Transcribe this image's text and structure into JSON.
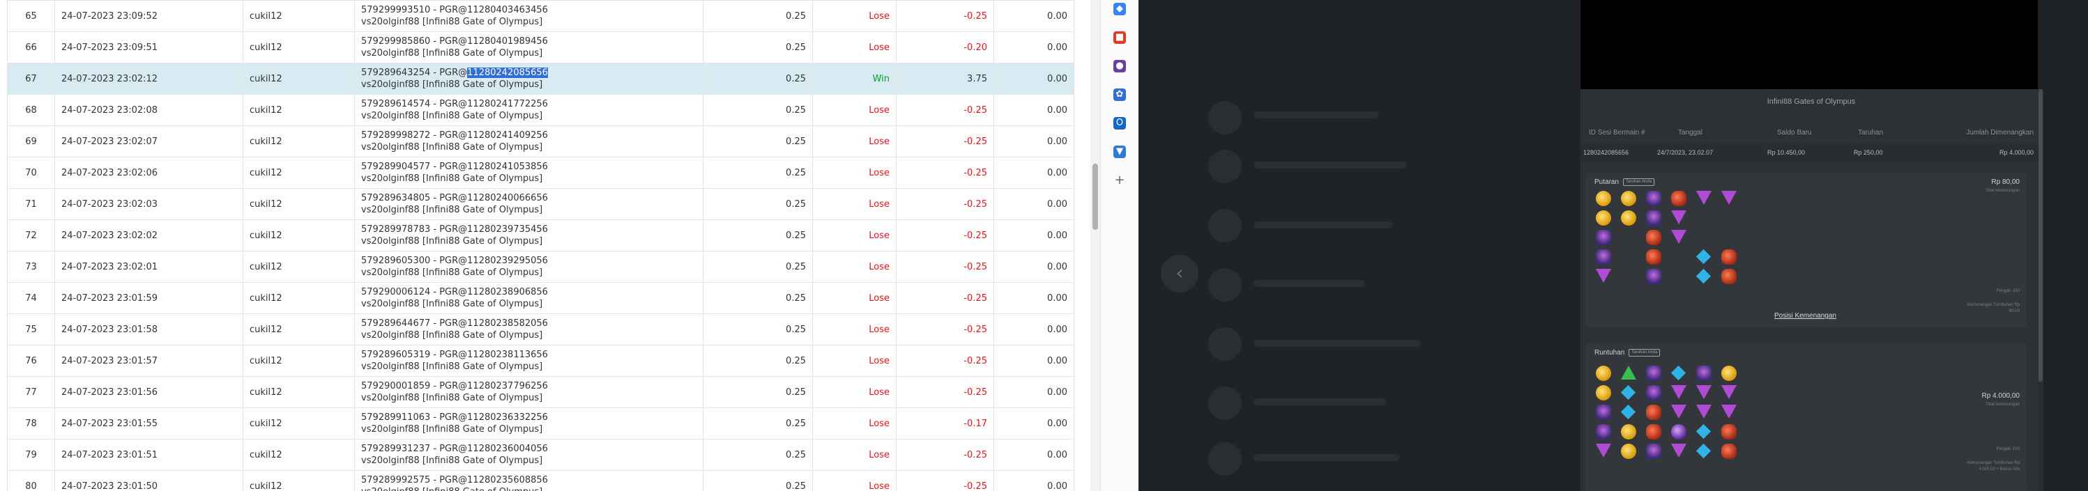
{
  "table": {
    "rows": [
      {
        "no": "65",
        "date": "24-07-2023 23:09:52",
        "user": "cukil12",
        "desc1": "579299993510 - PGR@11280403463456",
        "desc2": "vs20olginf88 [Infini88 Gate of Olympus]",
        "bet": "0.25",
        "result": "Lose",
        "amount": "-0.25",
        "balance": "0.00"
      },
      {
        "no": "66",
        "date": "24-07-2023 23:09:51",
        "user": "cukil12",
        "desc1": "579299985860 - PGR@11280401989456",
        "desc2": "vs20olginf88 [Infini88 Gate of Olympus]",
        "bet": "0.25",
        "result": "Lose",
        "amount": "-0.20",
        "balance": "0.00"
      },
      {
        "no": "67",
        "date": "24-07-2023 23:02:12",
        "user": "cukil12",
        "desc1": "579289643254 - PGR@",
        "desc1_hl": "11280242085656",
        "desc2": "vs20olginf88 [Infini88 Gate of Olympus]",
        "bet": "0.25",
        "result": "Win",
        "amount": "3.75",
        "balance": "0.00",
        "selected": true
      },
      {
        "no": "68",
        "date": "24-07-2023 23:02:08",
        "user": "cukil12",
        "desc1": "579289614574 - PGR@11280241772256",
        "desc2": "vs20olginf88 [Infini88 Gate of Olympus]",
        "bet": "0.25",
        "result": "Lose",
        "amount": "-0.25",
        "balance": "0.00"
      },
      {
        "no": "69",
        "date": "24-07-2023 23:02:07",
        "user": "cukil12",
        "desc1": "579289998272 - PGR@11280241409256",
        "desc2": "vs20olginf88 [Infini88 Gate of Olympus]",
        "bet": "0.25",
        "result": "Lose",
        "amount": "-0.25",
        "balance": "0.00"
      },
      {
        "no": "70",
        "date": "24-07-2023 23:02:06",
        "user": "cukil12",
        "desc1": "579289904577 - PGR@11280241053856",
        "desc2": "vs20olginf88 [Infini88 Gate of Olympus]",
        "bet": "0.25",
        "result": "Lose",
        "amount": "-0.25",
        "balance": "0.00"
      },
      {
        "no": "71",
        "date": "24-07-2023 23:02:03",
        "user": "cukil12",
        "desc1": "579289634805 - PGR@11280240066656",
        "desc2": "vs20olginf88 [Infini88 Gate of Olympus]",
        "bet": "0.25",
        "result": "Lose",
        "amount": "-0.25",
        "balance": "0.00"
      },
      {
        "no": "72",
        "date": "24-07-2023 23:02:02",
        "user": "cukil12",
        "desc1": "579289978783 - PGR@11280239735456",
        "desc2": "vs20olginf88 [Infini88 Gate of Olympus]",
        "bet": "0.25",
        "result": "Lose",
        "amount": "-0.25",
        "balance": "0.00"
      },
      {
        "no": "73",
        "date": "24-07-2023 23:02:01",
        "user": "cukil12",
        "desc1": "579289605300 - PGR@11280239295056",
        "desc2": "vs20olginf88 [Infini88 Gate of Olympus]",
        "bet": "0.25",
        "result": "Lose",
        "amount": "-0.25",
        "balance": "0.00"
      },
      {
        "no": "74",
        "date": "24-07-2023 23:01:59",
        "user": "cukil12",
        "desc1": "579290006124 - PGR@11280238906856",
        "desc2": "vs20olginf88 [Infini88 Gate of Olympus]",
        "bet": "0.25",
        "result": "Lose",
        "amount": "-0.25",
        "balance": "0.00"
      },
      {
        "no": "75",
        "date": "24-07-2023 23:01:58",
        "user": "cukil12",
        "desc1": "579289644677 - PGR@11280238582056",
        "desc2": "vs20olginf88 [Infini88 Gate of Olympus]",
        "bet": "0.25",
        "result": "Lose",
        "amount": "-0.25",
        "balance": "0.00"
      },
      {
        "no": "76",
        "date": "24-07-2023 23:01:57",
        "user": "cukil12",
        "desc1": "579289605319 - PGR@11280238113656",
        "desc2": "vs20olginf88 [Infini88 Gate of Olympus]",
        "bet": "0.25",
        "result": "Lose",
        "amount": "-0.25",
        "balance": "0.00"
      },
      {
        "no": "77",
        "date": "24-07-2023 23:01:56",
        "user": "cukil12",
        "desc1": "579290001859 - PGR@11280237796256",
        "desc2": "vs20olginf88 [Infini88 Gate of Olympus]",
        "bet": "0.25",
        "result": "Lose",
        "amount": "-0.25",
        "balance": "0.00"
      },
      {
        "no": "78",
        "date": "24-07-2023 23:01:55",
        "user": "cukil12",
        "desc1": "579289911063 - PGR@11280236332256",
        "desc2": "vs20olginf88 [Infini88 Gate of Olympus]",
        "bet": "0.25",
        "result": "Lose",
        "amount": "-0.17",
        "balance": "0.00"
      },
      {
        "no": "79",
        "date": "24-07-2023 23:01:51",
        "user": "cukil12",
        "desc1": "579289931237 - PGR@11280236004056",
        "desc2": "vs20olginf88 [Infini88 Gate of Olympus]",
        "bet": "0.25",
        "result": "Lose",
        "amount": "-0.25",
        "balance": "0.00"
      },
      {
        "no": "80",
        "date": "24-07-2023 23:01:50",
        "user": "cukil12",
        "desc1": "579289992575 - PGR@11280235608856",
        "desc2": "vs20olginf88 [Infini88 Gate of Olympus]",
        "bet": "0.25",
        "result": "Lose",
        "amount": "-0.25",
        "balance": "0.00"
      }
    ]
  },
  "extensions": [
    {
      "icon": "tag-icon",
      "color": "#3b82f6",
      "glyph": "◆"
    },
    {
      "icon": "toolbox-icon",
      "color": "#e03b2a",
      "glyph": "■"
    },
    {
      "icon": "person-icon",
      "color": "#6b3fa0",
      "glyph": "●"
    },
    {
      "icon": "gear-icon",
      "color": "#2f6fd6",
      "glyph": "✿"
    },
    {
      "icon": "outlook-icon",
      "color": "#1368c4",
      "glyph": "O"
    },
    {
      "icon": "cart-icon",
      "color": "#2f7ad6",
      "glyph": "▼"
    },
    {
      "icon": "plus-icon",
      "color": "transparent",
      "glyph": "+"
    }
  ],
  "game": {
    "nav_glyph": "‹",
    "title": "Infini88 Gates of Olympus",
    "headers": {
      "id": "ID Sesi Bermain #",
      "date": "Tanggal",
      "balance": "Saldo Baru",
      "bet": "Taruhan",
      "win": "Jumlah Dimenangkan"
    },
    "row": {
      "id": "1280242085656",
      "date": "24/7/2023, 23.02.07",
      "balance": "Rp 10.450,00",
      "bet": "Rp 250,00",
      "win": "Rp 4.000,00"
    },
    "card1": {
      "label": "Putaran",
      "tag": "Taruhan Anda",
      "amount": "Rp 80,00",
      "amount_sub": "Total kemenangan",
      "link": "Posisi Kemenangan",
      "note1": "Pengali: 100",
      "note2": "Kemenangan Tumbuhan Rp 80,00"
    },
    "card2": {
      "label": "Runtuhan",
      "tag": "Taruhan Anda",
      "amount": "Rp 4.000,00",
      "amount_sub": "Total kemenangan",
      "note1": "Pengali: 100",
      "note2": "Kemenangan Tumbuhan Rp 4.000,00 + Bonus 50x"
    }
  },
  "colors": {
    "selected_row": "#d9ebf2",
    "lose": "#e0141e",
    "win": "#0f9b2c",
    "dark_bg": "#202326",
    "panel_bg": "#2d3135"
  }
}
